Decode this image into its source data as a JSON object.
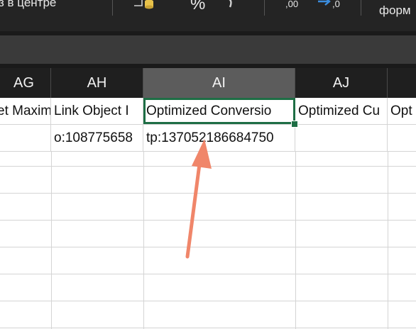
{
  "ribbon": {
    "left_text": "з в центре",
    "percent_glyph": "%",
    "decimal_decrease_label": ",00",
    "decimal_increase_label": ",0",
    "right_text": "форм"
  },
  "columns": [
    {
      "letter": "AG",
      "selected": false
    },
    {
      "letter": "AH",
      "selected": false
    },
    {
      "letter": "AI",
      "selected": true
    },
    {
      "letter": "AJ",
      "selected": false
    },
    {
      "letter": "",
      "selected": false
    }
  ],
  "rows": [
    [
      "et Maxim",
      "Link Object I",
      "Optimized Conversio",
      "Optimized Cu",
      "Opt"
    ],
    [
      "",
      "o:108775658",
      "tp:137052186684750",
      "",
      ""
    ]
  ],
  "colors": {
    "active_cell_border": "#1e6e45",
    "annotation_arrow": "#f0866a",
    "selected_header": "#5c5c5c"
  }
}
